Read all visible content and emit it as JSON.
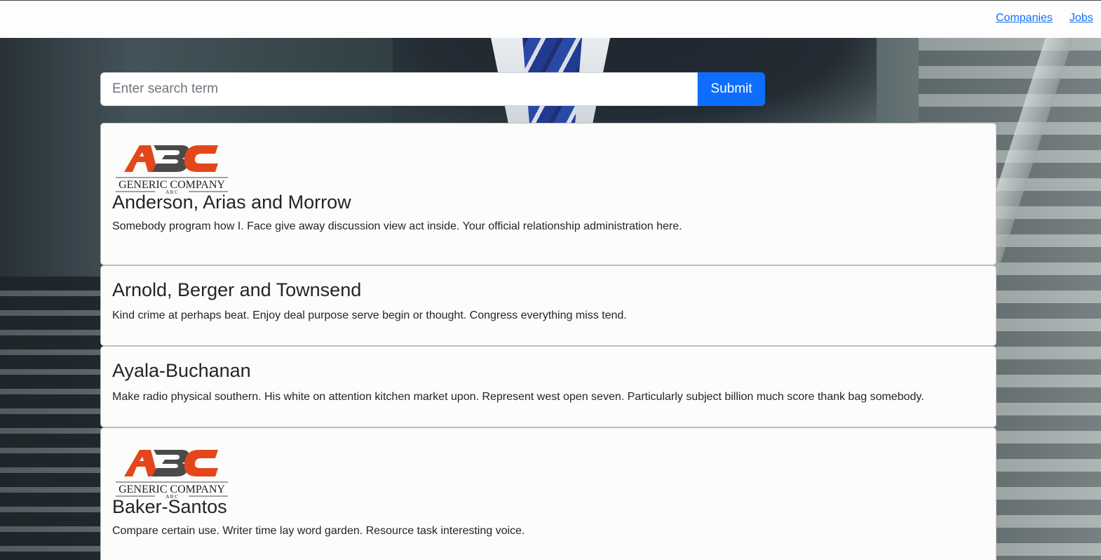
{
  "nav": {
    "links": [
      "Companies",
      "Jobs"
    ]
  },
  "search": {
    "placeholder": "Enter search term",
    "value": "",
    "submit_label": "Submit"
  },
  "logo": {
    "text_main": "Generic Company",
    "text_sub": "A B C",
    "mark": "ABC",
    "colors": {
      "orange": "#e4461b",
      "grey": "#4a4a4a"
    }
  },
  "companies": [
    {
      "name": "Anderson, Arias and Morrow",
      "description": "Somebody program how I. Face give away discussion view act inside. Your official relationship administration here.",
      "has_logo": true
    },
    {
      "name": "Arnold, Berger and Townsend",
      "description": "Kind crime at perhaps beat. Enjoy deal purpose serve begin or thought. Congress everything miss tend.",
      "has_logo": false
    },
    {
      "name": "Ayala-Buchanan",
      "description": "Make radio physical southern. His white on attention kitchen market upon. Represent west open seven. Particularly subject billion much score thank bag somebody.",
      "has_logo": false
    },
    {
      "name": "Baker-Santos",
      "description": "Compare certain use. Writer time lay word garden. Resource task interesting voice.",
      "has_logo": true
    }
  ],
  "colors": {
    "link": "#0d6efd",
    "button": "#0d6efd",
    "card_bg": "#fcfcfb",
    "text": "#212529"
  }
}
